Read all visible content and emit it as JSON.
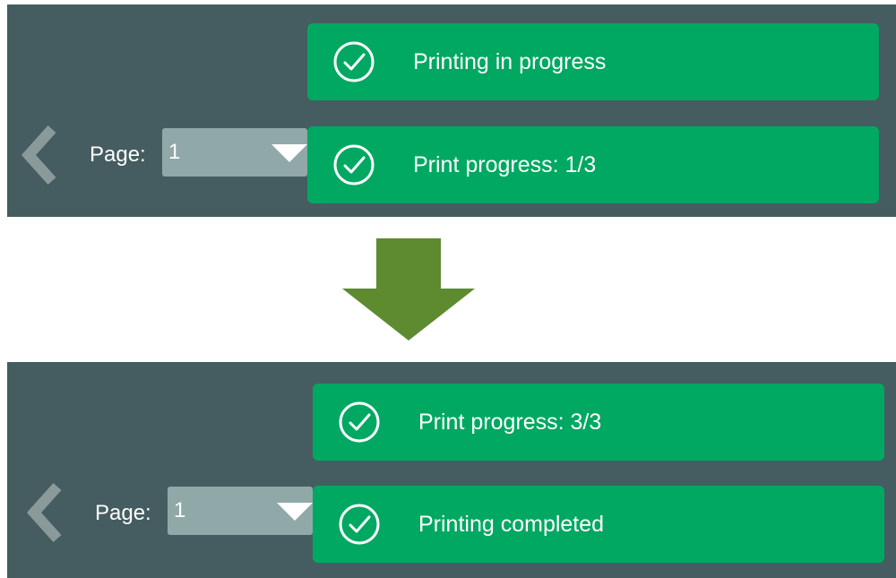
{
  "before": {
    "page_label": "Page:",
    "page_value": "1",
    "notifications": [
      {
        "icon": "check-circle-icon",
        "text": "Printing in progress"
      },
      {
        "icon": "check-circle-icon",
        "text": "Print progress: 1/3"
      }
    ]
  },
  "after": {
    "page_label": "Page:",
    "page_value": "1",
    "notifications": [
      {
        "icon": "check-circle-icon",
        "text": "Print progress: 3/3"
      },
      {
        "icon": "check-circle-icon",
        "text": "Printing completed"
      }
    ]
  },
  "transition_icon": "down-arrow-icon",
  "colors": {
    "panel_bg": "#455d60",
    "toast_bg": "#00a862",
    "select_bg": "#90a8a8",
    "arrow": "#5e8a30"
  }
}
